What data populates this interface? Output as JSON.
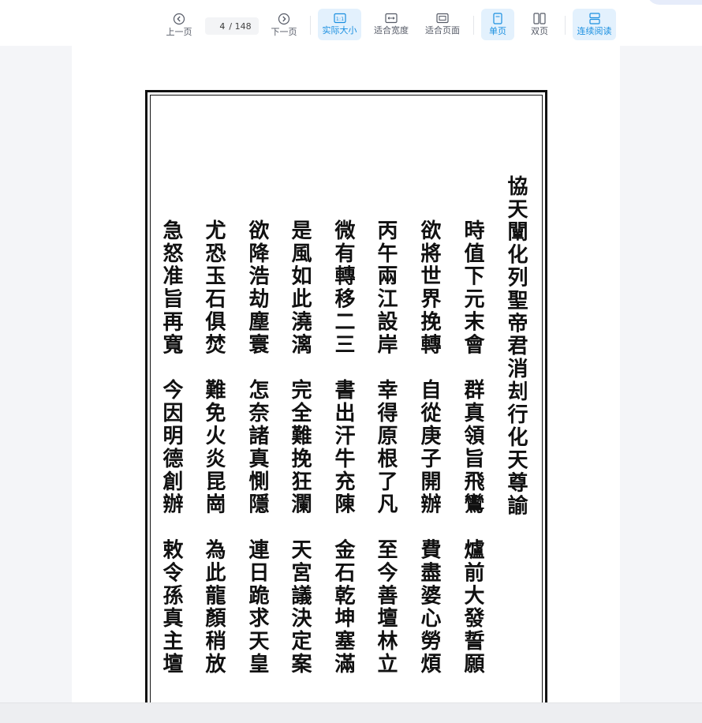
{
  "toolbar": {
    "prev_label": "上一页",
    "next_label": "下一页",
    "current_page": "4",
    "total_pages": "/ 148",
    "actual_size_label": "实际大小",
    "fit_width_label": "适合宽度",
    "fit_page_label": "适合页面",
    "single_page_label": "单页",
    "double_page_label": "双页",
    "continuous_label": "连续阅读",
    "icons": {
      "prev": "chevron-left-circle-icon",
      "next": "chevron-right-circle-icon",
      "actual_size": "actual-size-icon",
      "fit_width": "fit-width-icon",
      "fit_page": "fit-page-icon",
      "single_page": "single-page-icon",
      "double_page": "double-page-icon",
      "continuous": "continuous-scroll-icon"
    },
    "accent_color": "#1a8fe0",
    "active_bg": "#e3f1fd"
  },
  "document": {
    "title": "協天闡化列聖帝君消刦行化天尊諭",
    "lines": [
      "時值下元末會　群真領旨飛鸞　爐前大發誓願",
      "欲將世界挽轉　自從庚子開辦　費盡婆心勞煩",
      "丙午兩江設岸　幸得原根了凡　至今善壇林立",
      "微有轉移二三　書出汗牛充陳　金石乾坤塞滿",
      "是風如此澆漓　完全難挽狂瀾　天宮議決定案",
      "欲降浩劫塵寰　怎奈諸真惻隱　連日跪求天皇",
      "尤恐玉石俱焚　難免火炎昆崗　為此龍顏稍放",
      "急怒准旨再寬　今因明德創辦　敕令孫真主壇"
    ]
  }
}
